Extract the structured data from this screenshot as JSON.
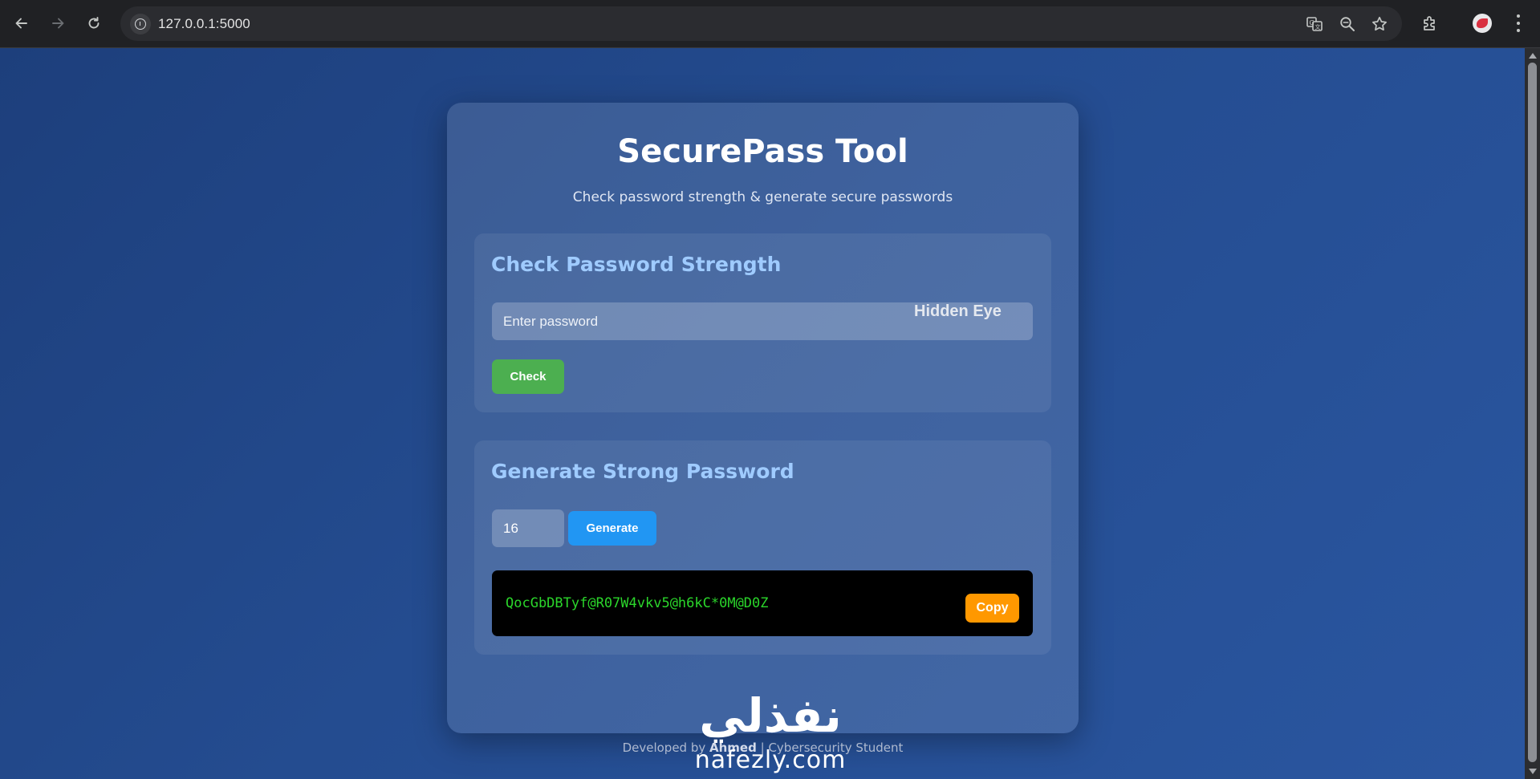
{
  "browser": {
    "url": "127.0.0.1:5000"
  },
  "app": {
    "title": "SecurePass Tool",
    "subtitle": "Check password strength & generate secure passwords"
  },
  "check_section": {
    "title": "Check Password Strength",
    "password_placeholder": "Enter password",
    "password_value": "",
    "toggle_label": "Hidden Eye",
    "check_button": "Check"
  },
  "generate_section": {
    "title": "Generate Strong Password",
    "length_value": "16",
    "generate_button": "Generate",
    "generated_password": "QocGbDBTyf@R07W4vkv5@h6kC*0M@D0Z",
    "copy_button": "Copy"
  },
  "footer": {
    "prefix": "Developed by",
    "author": "Ahmed",
    "suffix": "| Cybersecurity Student"
  },
  "watermark": {
    "arabic": "نفذلي",
    "latin": "nafezly.com"
  },
  "colors": {
    "check_button": "#4caf50",
    "generate_button": "#2196f3",
    "copy_button": "#ff9800",
    "section_title": "#9fcbff",
    "password_output": "#2bd62b"
  }
}
